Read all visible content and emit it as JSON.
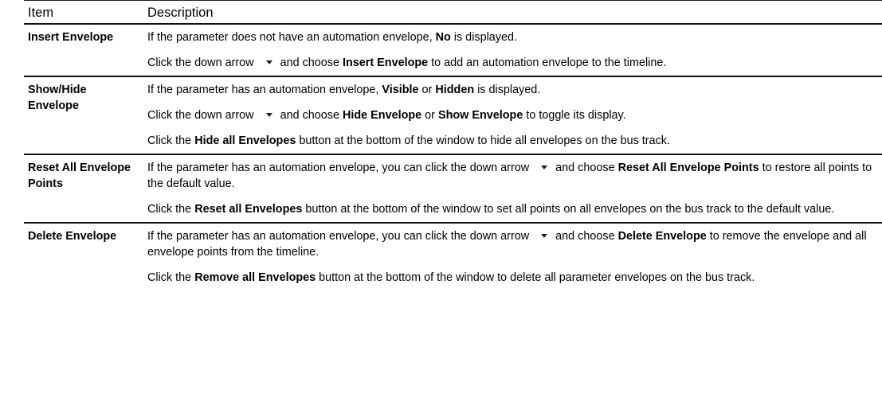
{
  "header": {
    "item": "Item",
    "description": "Description"
  },
  "rows": [
    {
      "item": "Insert Envelope",
      "paragraphs": [
        [
          {
            "t": "If the parameter does not have an automation envelope, "
          },
          {
            "t": "No",
            "b": true
          },
          {
            "t": " is displayed."
          }
        ],
        [
          {
            "t": "Click the down arrow"
          },
          {
            "icon": "down-arrow"
          },
          {
            "t": "and choose "
          },
          {
            "t": "Insert Envelope",
            "b": true
          },
          {
            "t": " to add an automation envelope to the timeline."
          }
        ]
      ]
    },
    {
      "item": "Show/Hide Envelope",
      "paragraphs": [
        [
          {
            "t": "If the parameter has an automation envelope, "
          },
          {
            "t": "Visible",
            "b": true
          },
          {
            "t": " or "
          },
          {
            "t": "Hidden",
            "b": true
          },
          {
            "t": " is displayed."
          }
        ],
        [
          {
            "t": "Click the down arrow"
          },
          {
            "icon": "down-arrow"
          },
          {
            "t": "and choose "
          },
          {
            "t": "Hide Envelope",
            "b": true
          },
          {
            "t": " or "
          },
          {
            "t": "Show Envelope",
            "b": true
          },
          {
            "t": " to toggle its display."
          }
        ],
        [
          {
            "t": "Click the "
          },
          {
            "t": "Hide all Envelopes",
            "b": true
          },
          {
            "t": " button at the bottom of the window to hide all envelopes on the bus track."
          }
        ]
      ]
    },
    {
      "item": "Reset All Envelope Points",
      "paragraphs": [
        [
          {
            "t": "If the parameter has an automation envelope, you can click the down arrow"
          },
          {
            "icon": "down-arrow"
          },
          {
            "t": "and choose "
          },
          {
            "t": "Reset All Envelope Points",
            "b": true
          },
          {
            "t": " to restore all points to the default value."
          }
        ],
        [
          {
            "t": "Click the "
          },
          {
            "t": "Reset all Envelopes",
            "b": true
          },
          {
            "t": " button at the bottom of the window to set all points on all envelopes on the bus track to the default value."
          }
        ]
      ]
    },
    {
      "item": "Delete Envelope",
      "paragraphs": [
        [
          {
            "t": "If the parameter has an automation envelope, you can click the down arrow"
          },
          {
            "icon": "down-arrow"
          },
          {
            "t": "and choose "
          },
          {
            "t": "Delete Envelope",
            "b": true
          },
          {
            "t": " to remove the envelope and all envelope points from the timeline."
          }
        ],
        [
          {
            "t": "Click the "
          },
          {
            "t": "Remove all Envelopes",
            "b": true
          },
          {
            "t": " button at the bottom of the window to delete all parameter envelopes on the bus track."
          }
        ]
      ]
    }
  ]
}
